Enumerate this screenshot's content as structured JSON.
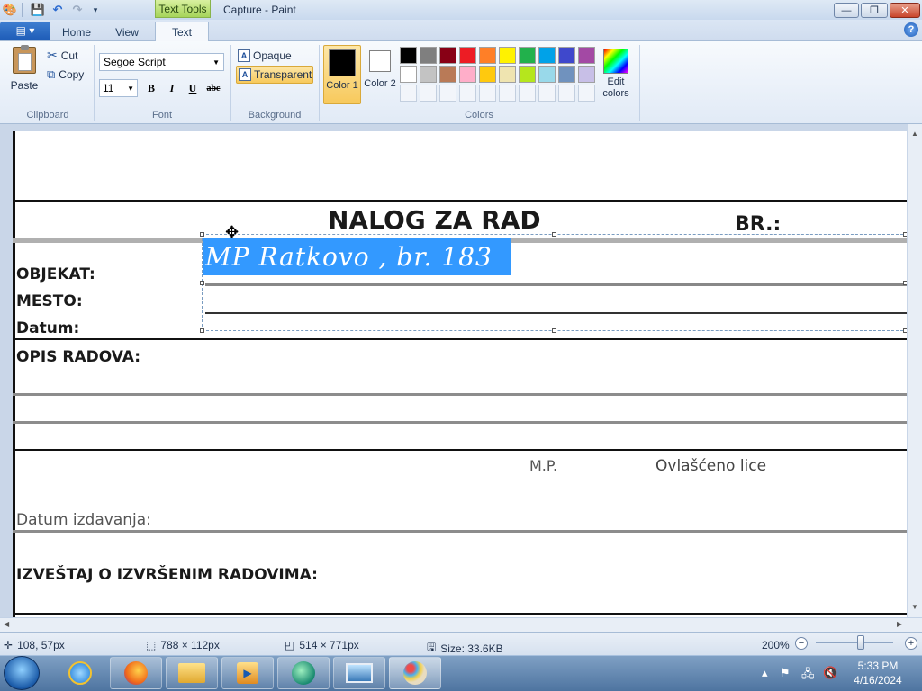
{
  "title_bar": {
    "contextual_tab": "Text Tools",
    "window_title": "Capture - Paint",
    "minimize": "—",
    "maximize": "❐",
    "close": "✕"
  },
  "tabs": {
    "file": "▤ ▾",
    "home": "Home",
    "view": "View",
    "text": "Text",
    "help": "?"
  },
  "clipboard": {
    "paste": "Paste",
    "cut": "Cut",
    "copy": "Copy",
    "group": "Clipboard"
  },
  "font": {
    "family": "Segoe Script",
    "size": "11",
    "bold": "B",
    "italic": "I",
    "underline": "U",
    "strike": "abc",
    "group": "Font"
  },
  "background": {
    "opaque": "Opaque",
    "transparent": "Transparent",
    "group": "Background"
  },
  "colors": {
    "color1_label": "Color 1",
    "color2_label": "Color 2",
    "color1_value": "#000000",
    "color2_value": "#ffffff",
    "edit_label": "Edit colors",
    "group": "Colors",
    "palette": [
      "#000000",
      "#7f7f7f",
      "#880015",
      "#ed1c24",
      "#ff7f27",
      "#fff200",
      "#22b14c",
      "#00a2e8",
      "#3f48cc",
      "#a349a4",
      "#ffffff",
      "#c3c3c3",
      "#b97a57",
      "#ffaec9",
      "#ffc90e",
      "#efe4b0",
      "#b5e61d",
      "#99d9ea",
      "#7092be",
      "#c8bfe7"
    ]
  },
  "document": {
    "title": "NALOG ZA RAD",
    "number_label": "BR.:",
    "objekat": "OBJEKAT:",
    "mesto": "MESTO:",
    "datum": "Datum:",
    "opis": "OPIS RADOVA:",
    "mp": "M.P.",
    "ovlasceno": "Ovlašćeno lice",
    "datum_izdavanja": "Datum izdavanja:",
    "izvestaj": "IZVEŠTAJ O IZVRŠENIM RADOVIMA:",
    "selected_text": "MP Ratkovo , br. 183"
  },
  "status": {
    "cursor_pos": "108, 57px",
    "selection_size": "788 × 112px",
    "image_size": "514 × 771px",
    "file_size": "Size: 33.6KB",
    "zoom": "200%"
  },
  "taskbar": {
    "time": "5:33 PM",
    "date": "4/16/2024"
  }
}
